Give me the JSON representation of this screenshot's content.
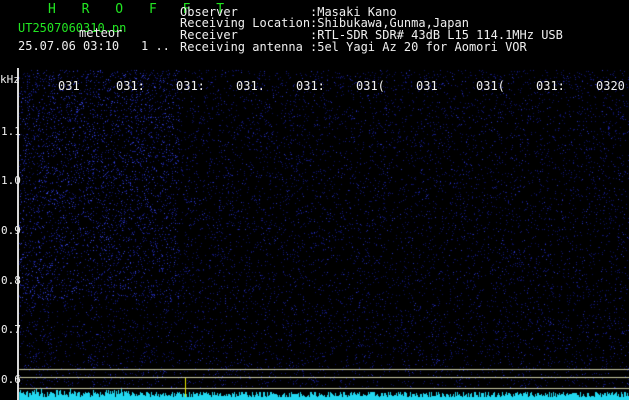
{
  "header": {
    "brand": "H R O F F T",
    "file_name": "UT2507060310.pn",
    "file_tag": "meteor",
    "datetime": "25.07.06 03:10",
    "indicator": "1 .."
  },
  "info": [
    {
      "label": "Observer",
      "value": ":Masaki Kano"
    },
    {
      "label": "Receiving Location",
      "value": ":Shibukawa,Gunma,Japan"
    },
    {
      "label": "Receiver",
      "value": ":RTL-SDR SDR# 43dB L15 114.1MHz USB"
    },
    {
      "label": "Receiving antenna",
      "value": ":5el Yagi Az 20 for Aomori VOR"
    }
  ],
  "axis": {
    "unit": "kHz",
    "y_ticks": [
      "1.1",
      "1.0",
      "0.9",
      "0.8",
      "0.7",
      "0.6"
    ],
    "x_ticks": [
      "031",
      "031:",
      "031:",
      "031.",
      "031:",
      "031(",
      "031",
      "031(",
      "031:",
      "0320"
    ]
  },
  "colors": {
    "background": "#000000",
    "noise": "#1a1f8c",
    "signal": "#8fa0ff",
    "spectrum": "#22d8f0",
    "marker": "#e6e600",
    "guide": "#c8c8a0",
    "text": "#f0f0f0",
    "brand": "#22e622"
  }
}
